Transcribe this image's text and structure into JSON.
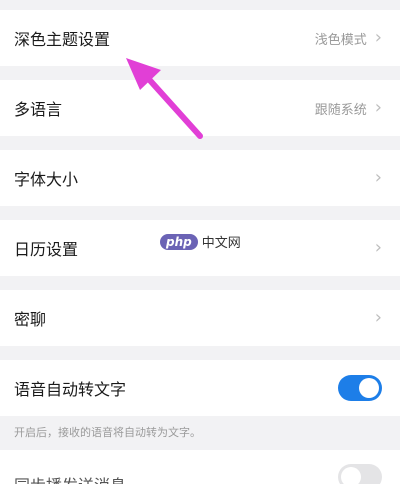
{
  "settings": {
    "dark_theme": {
      "label": "深色主题设置",
      "value": "浅色模式"
    },
    "language": {
      "label": "多语言",
      "value": "跟随系统"
    },
    "font_size": {
      "label": "字体大小"
    },
    "calendar": {
      "label": "日历设置"
    },
    "secret_chat": {
      "label": "密聊"
    },
    "voice_to_text": {
      "label": "语音自动转文字",
      "enabled": true,
      "note": "开启后，接收的语音将自动转为文字。"
    },
    "partial_row": {
      "label": "同步播发送消息",
      "enabled": false
    }
  },
  "chevron_glyph": "›",
  "watermark": {
    "logo": "php",
    "text": "中文网"
  },
  "colors": {
    "accent": "#1d7ee8",
    "arrow": "#e13fd6"
  }
}
